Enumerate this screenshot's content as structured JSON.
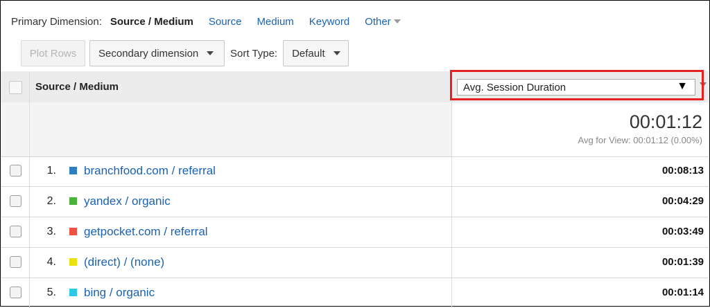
{
  "dimension_bar": {
    "label": "Primary Dimension:",
    "active": "Source / Medium",
    "links": [
      "Source",
      "Medium",
      "Keyword"
    ],
    "other": "Other"
  },
  "toolbar": {
    "plot_rows": "Plot Rows",
    "secondary_dimension": "Secondary dimension",
    "sort_type_label": "Sort Type:",
    "sort_type_value": "Default"
  },
  "table": {
    "source_header": "Source / Medium",
    "metric_select": "Avg. Session Duration",
    "metric_select_icon": "▼",
    "summary_total": "00:01:12",
    "summary_sub": "Avg for View: 00:01:12 (0.00%)",
    "rows": [
      {
        "num": "1.",
        "source": "branchfood.com / referral",
        "value": "00:08:13",
        "color": "#2e7ec2"
      },
      {
        "num": "2.",
        "source": "yandex / organic",
        "value": "00:04:29",
        "color": "#4bb33b"
      },
      {
        "num": "3.",
        "source": "getpocket.com / referral",
        "value": "00:03:49",
        "color": "#ef5142"
      },
      {
        "num": "4.",
        "source": "(direct) / (none)",
        "value": "00:01:39",
        "color": "#e8e20f"
      },
      {
        "num": "5.",
        "source": "bing / organic",
        "value": "00:01:14",
        "color": "#2fc9e6"
      }
    ]
  },
  "colors": {
    "link": "#1a62b4",
    "highlight": "#e52020"
  }
}
